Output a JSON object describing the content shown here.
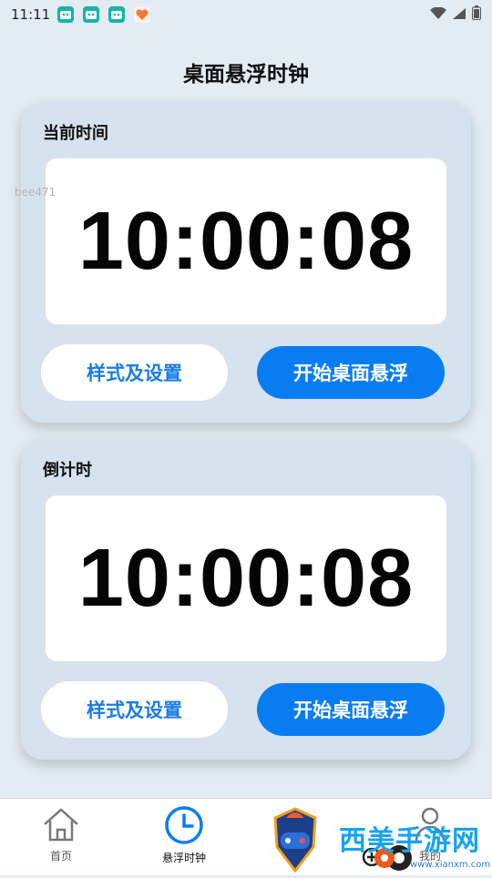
{
  "status_bar": {
    "time": "11:11",
    "notifications": [
      "app-notif-1",
      "app-notif-2",
      "app-notif-3",
      "heart-app-notif"
    ]
  },
  "header": {
    "title": "桌面悬浮时钟"
  },
  "watermark": {
    "text": "bee471"
  },
  "current_time_card": {
    "label": "当前时间",
    "time": "10:00:08",
    "style_button": "样式及设置",
    "float_button": "开始桌面悬浮"
  },
  "countdown_card": {
    "label": "倒计时",
    "time": "10:00:08",
    "style_button": "样式及设置",
    "float_button": "开始桌面悬浮"
  },
  "tab_bar": {
    "items": [
      {
        "label": "首页",
        "icon": "home-icon"
      },
      {
        "label": "悬浮时钟",
        "icon": "clock-icon"
      },
      {
        "label": "",
        "icon": "plus-icon"
      },
      {
        "label": "我的",
        "icon": "person-icon"
      }
    ]
  },
  "logo": {
    "text": "西美手游网",
    "url_text": "www.xianxm.com"
  },
  "colors": {
    "background": "#e3ebf3",
    "card": "#d6e2ee",
    "accent": "#0a7cf2",
    "accent_text": "#1b7ce6"
  }
}
